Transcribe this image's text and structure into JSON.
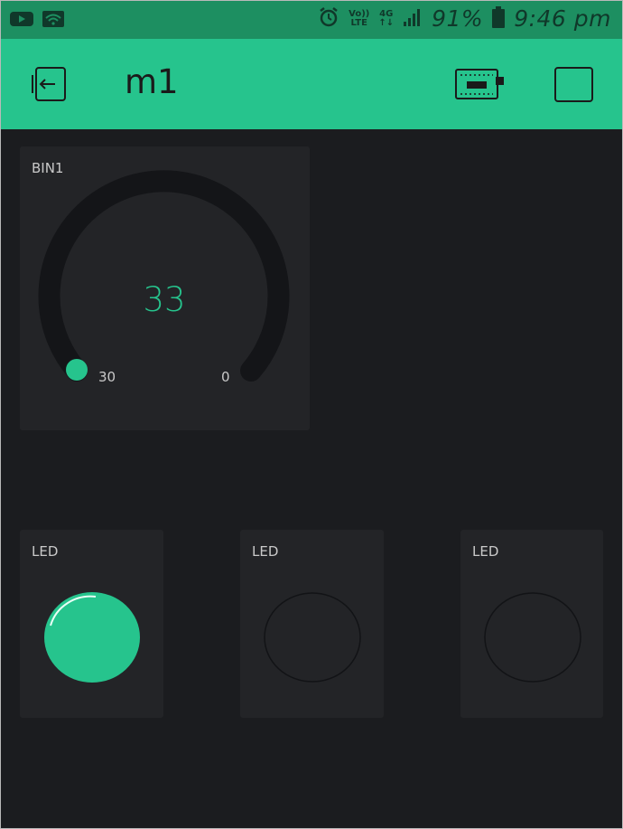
{
  "status_bar": {
    "icons": [
      "youtube-icon",
      "wifi-icon",
      "alarm-icon",
      "volte-icon",
      "4g-icon",
      "signal-icon",
      "battery-icon"
    ],
    "volte_top": "Vo))",
    "volte_bottom": "LTE",
    "network": "4G",
    "battery": "91%",
    "time": "9:46 pm"
  },
  "header": {
    "title": "m1",
    "icons": [
      "exit-icon",
      "device-icon",
      "stop-icon"
    ],
    "color": "#26c48d"
  },
  "gauge": {
    "label": "BIN1",
    "value": "33",
    "min_label": "30",
    "max_label": "0",
    "accent": "#26c48d"
  },
  "leds": [
    {
      "label": "LED",
      "state": "on",
      "color": "#26c48d"
    },
    {
      "label": "LED",
      "state": "off"
    },
    {
      "label": "LED",
      "state": "off"
    }
  ]
}
